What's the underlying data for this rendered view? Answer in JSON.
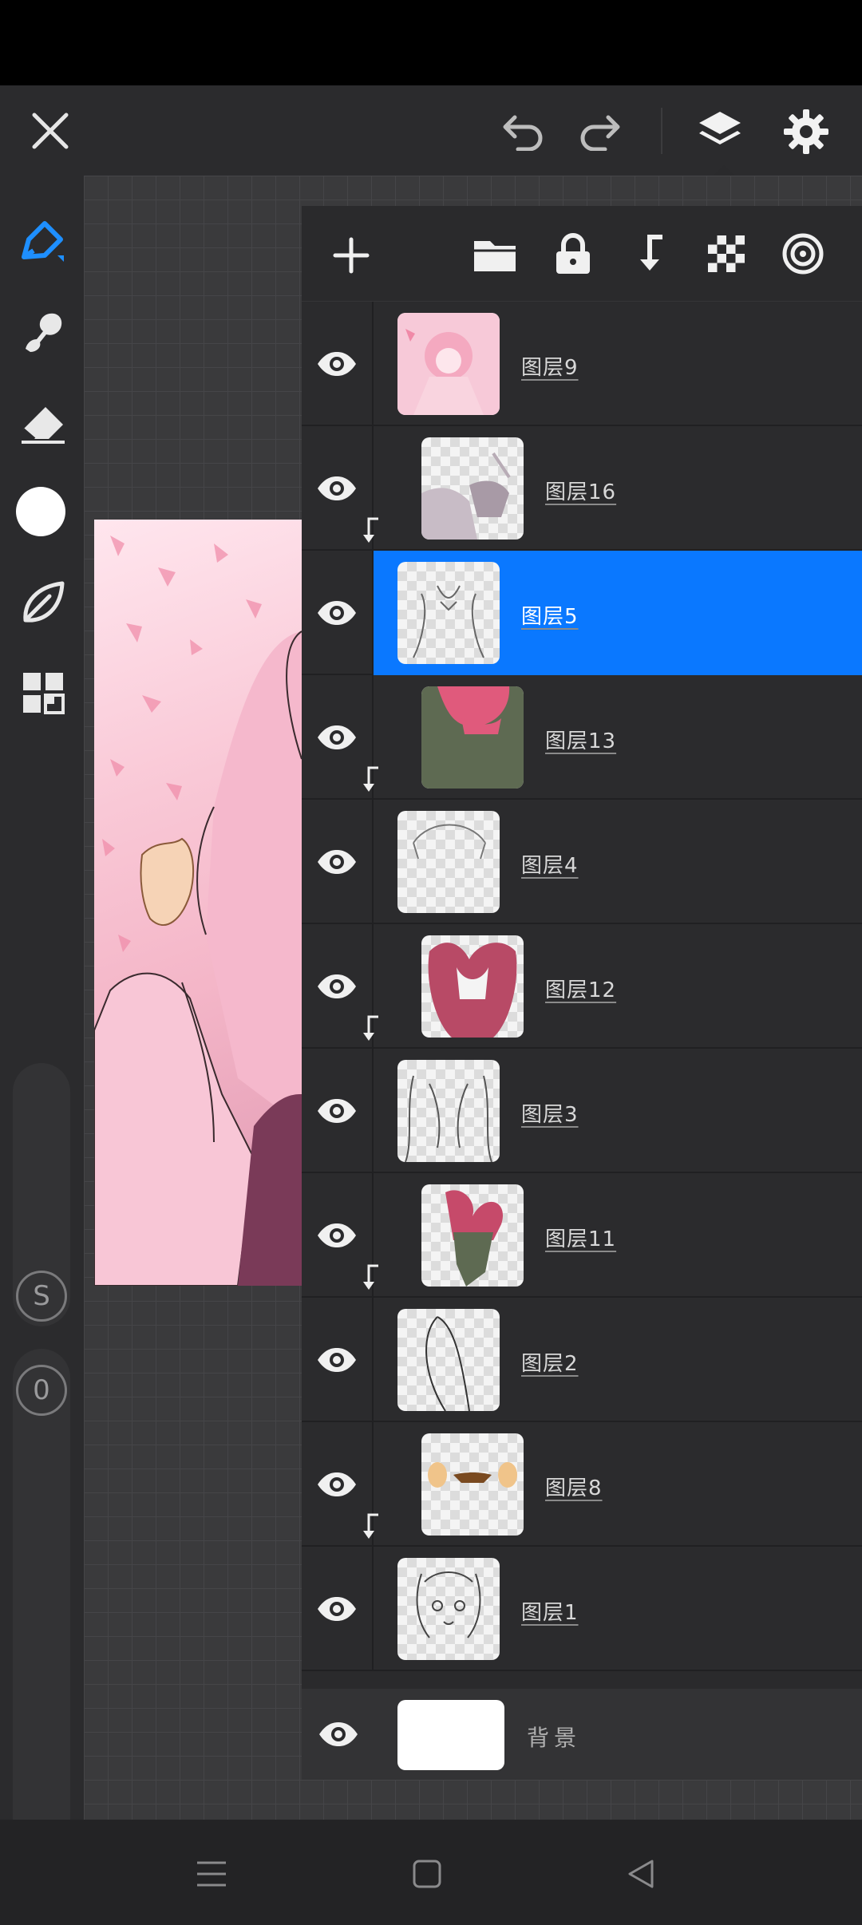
{
  "header": {
    "close_icon": "close-icon",
    "undo_icon": "undo-icon",
    "redo_icon": "redo-icon",
    "layers_icon": "layers-icon",
    "settings_icon": "gear-icon"
  },
  "tools": {
    "items": [
      "brush",
      "smudge",
      "eraser",
      "color",
      "leaf",
      "grid"
    ],
    "color_value": "#ffffff",
    "slider_labels": [
      "S",
      "0"
    ]
  },
  "layers_toolbar": {
    "icons": [
      "add-layer-icon",
      "folder-icon",
      "lock-icon",
      "clip-icon",
      "alpha-lock-icon",
      "reference-icon"
    ]
  },
  "layers": [
    {
      "name": "图层9",
      "clipped": false,
      "selected": false
    },
    {
      "name": "图层16",
      "clipped": true,
      "selected": false
    },
    {
      "name": "图层5",
      "clipped": false,
      "selected": true
    },
    {
      "name": "图层13",
      "clipped": true,
      "selected": false
    },
    {
      "name": "图层4",
      "clipped": false,
      "selected": false
    },
    {
      "name": "图层12",
      "clipped": true,
      "selected": false
    },
    {
      "name": "图层3",
      "clipped": false,
      "selected": false
    },
    {
      "name": "图层11",
      "clipped": true,
      "selected": false
    },
    {
      "name": "图层2",
      "clipped": false,
      "selected": false
    },
    {
      "name": "图层8",
      "clipped": true,
      "selected": false
    },
    {
      "name": "图层1",
      "clipped": false,
      "selected": false
    }
  ],
  "background_layer": {
    "name": "背景"
  },
  "colors": {
    "accent": "#0a78ff",
    "panel": "#2a2a2c",
    "toolbar": "#2b2b2d"
  },
  "navbar": {
    "icons": [
      "menu-icon",
      "home-icon",
      "back-icon"
    ]
  }
}
